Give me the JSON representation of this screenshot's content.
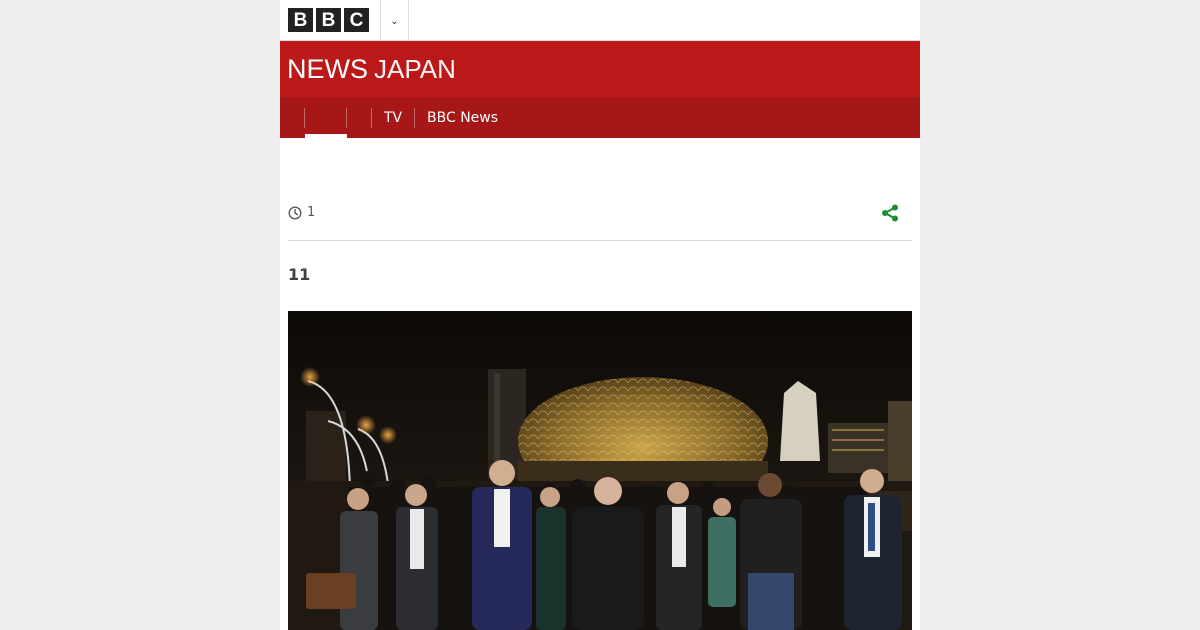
{
  "header": {
    "logo_letters": [
      "B",
      "B",
      "C"
    ],
    "more_icon": "chevron-down-icon"
  },
  "masthead": {
    "brand": "NEWS",
    "edition": "JAPAN"
  },
  "nav": {
    "items": [
      {
        "label": "TV"
      },
      {
        "label": "BBC News"
      }
    ]
  },
  "article": {
    "time_icon": "clock-icon",
    "timestamp": "1",
    "share_icon": "share-icon",
    "intro": "11"
  },
  "colors": {
    "brand_red": "#bb1919",
    "nav_red": "#a81717",
    "share_green": "#1c8c33"
  }
}
